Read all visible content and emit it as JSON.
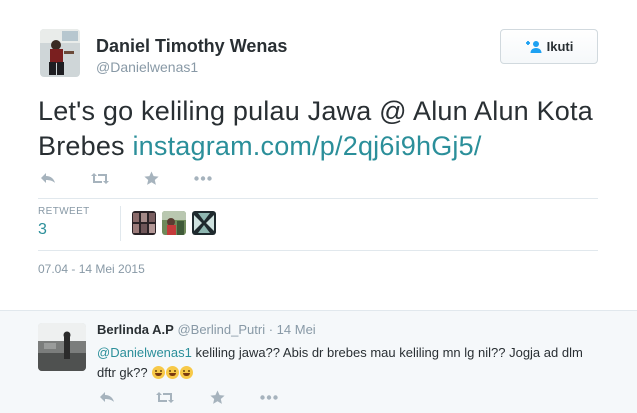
{
  "tweet": {
    "author": {
      "name": "Daniel Timothy Wenas",
      "handle": "@Danielwenas1"
    },
    "follow_button": {
      "label": "Ikuti",
      "icon": "follow-person-plus-icon"
    },
    "text_plain": "Let's go keliling pulau Jawa @ Alun Alun Kota Brebes ",
    "text_link": "instagram.com/p/2qj6i9hGj5/",
    "actions": [
      "reply-icon",
      "retweet-icon",
      "favorite-star-icon",
      "more-dots-icon"
    ],
    "stats": {
      "retweet_label": "RETWEET",
      "retweet_count": "3"
    },
    "timestamp": "07.04 - 14 Mei 2015"
  },
  "reply": {
    "author_name": "Berlinda A.P",
    "handle": "@Berlind_Putri",
    "separator": "·",
    "time": "14 Mei",
    "mention": "@Danielwenas1",
    "text": " keliling jawa?? Abis dr brebes mau keliling mn lg nil?? Jogja ad dlm dftr gk?? ",
    "actions": [
      "reply-icon",
      "retweet-icon",
      "favorite-star-icon",
      "more-dots-icon"
    ]
  },
  "colors": {
    "link": "#2b8f9a",
    "muted": "#8899a6",
    "text": "#292f33",
    "divider": "#e1e8ed",
    "reply_bg": "#f5f8fa"
  }
}
